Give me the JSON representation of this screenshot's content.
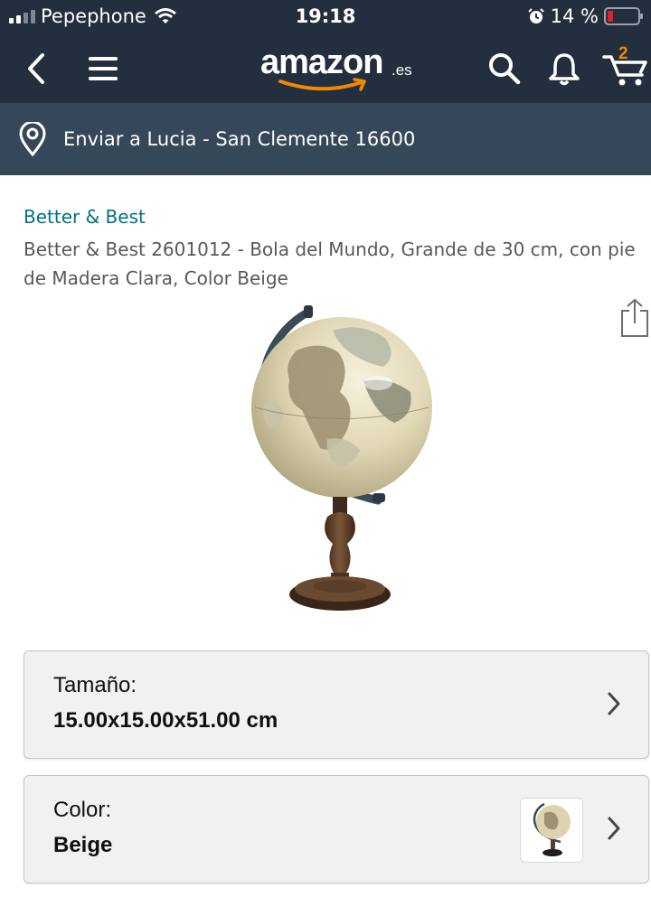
{
  "status_bar": {
    "carrier": "Pepephone",
    "time": "19:18",
    "battery": "14 %"
  },
  "nav": {
    "logo_text": "amazon",
    "logo_tld": ".es",
    "cart_count": "2",
    "icons": [
      "back-icon",
      "menu-icon",
      "search-icon",
      "bell-icon",
      "cart-icon"
    ]
  },
  "delivery": {
    "text": "Enviar a Lucia - San Clemente 16600",
    "icon": "location-pin-icon"
  },
  "product": {
    "brand": "Better & Best",
    "title": "Better & Best 2601012 - Bola del Mundo, Grande de 30 cm, con pie de Madera Clara, Color Beige"
  },
  "options": {
    "size": {
      "label": "Tamaño:",
      "value": "15.00x15.00x51.00 cm"
    },
    "color": {
      "label": "Color:",
      "value": "Beige"
    }
  },
  "colors": {
    "header": "#232f3e",
    "subheader": "#37475a",
    "link": "#007185",
    "cart_badge": "#f08804",
    "battery_low": "#e0202a"
  }
}
